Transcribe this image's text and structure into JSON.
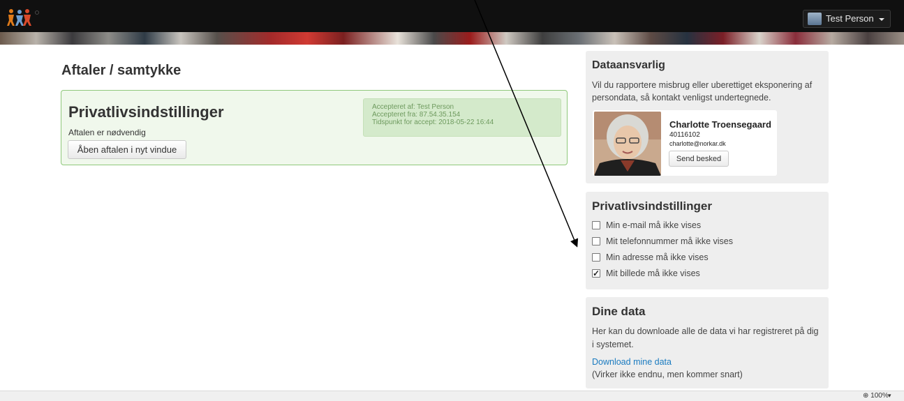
{
  "header": {
    "user_name": "Test Person"
  },
  "main": {
    "page_title": "Aftaler / samtykke",
    "consent": {
      "title": "Privatlivsindstillinger",
      "subtitle": "Aftalen er nødvendig",
      "open_button": "Åben aftalen i nyt vindue",
      "accepted_by": "Accepteret af: Test Person",
      "accepted_from": "Accepteret fra: 87.54.35.154",
      "accepted_time": "Tidspunkt for accept: 2018-05-22 16:44"
    }
  },
  "sidebar": {
    "data_responsible": {
      "title": "Dataansvarlig",
      "description": "Vil du rapportere misbrug eller uberettiget eksponering af persondata, så kontakt venligst undertegnede.",
      "contact": {
        "name": "Charlotte Troensegaard",
        "phone": "40116102",
        "email": "charlotte@norkar.dk",
        "send_button": "Send besked"
      }
    },
    "privacy": {
      "title": "Privatlivsindstillinger",
      "options": [
        {
          "label": "Min e-mail må ikke vises",
          "checked": false
        },
        {
          "label": "Mit telefonnummer må ikke vises",
          "checked": false
        },
        {
          "label": "Min adresse må ikke vises",
          "checked": false
        },
        {
          "label": "Mit billede må ikke vises",
          "checked": true
        }
      ]
    },
    "your_data": {
      "title": "Dine data",
      "description": "Her kan du downloade alle de data vi har registreret på dig i systemet.",
      "download_link": "Download mine data",
      "note": "(Virker ikke endnu, men kommer snart)"
    }
  },
  "statusbar": {
    "zoom": "100%"
  }
}
